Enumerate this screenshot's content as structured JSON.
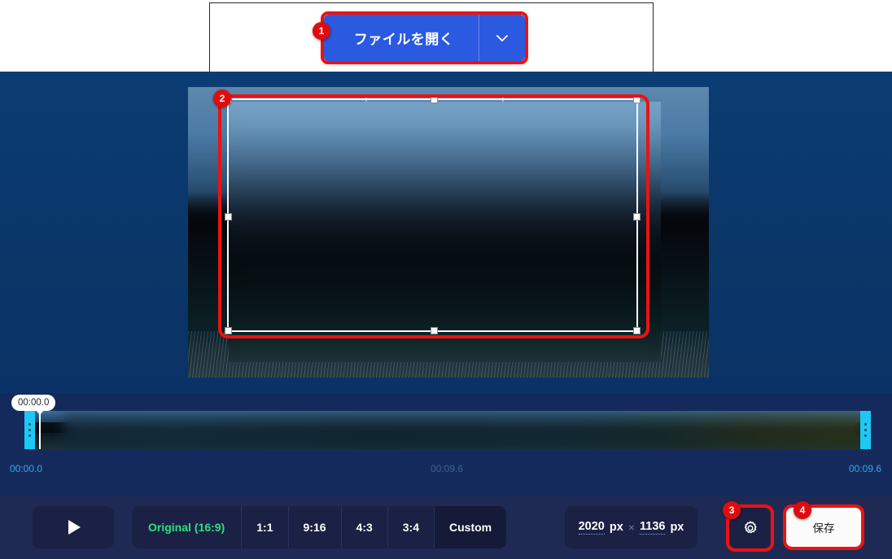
{
  "open_panel": {
    "button_label": "ファイルを開く",
    "caret_icon": "chevron-down-icon",
    "badge": "1",
    "accent_color": "#2b59e0"
  },
  "preview": {
    "badge": "2",
    "crop_overlay_color": "#ffffff",
    "highlight_color": "#ee1111"
  },
  "timeline": {
    "playhead_time": "00:00.0",
    "start_label": "00:00.0",
    "middle_label": "00:09.6",
    "end_label": "00:09.6",
    "trim_color": "#1ec8f5"
  },
  "toolbar": {
    "play_icon": "play-icon",
    "ratios": [
      {
        "label": "Original",
        "sub": "(16:9)",
        "selected": false,
        "highlight": true
      },
      {
        "label": "1:1",
        "sub": "",
        "selected": false,
        "highlight": false
      },
      {
        "label": "9:16",
        "sub": "",
        "selected": false,
        "highlight": false
      },
      {
        "label": "4:3",
        "sub": "",
        "selected": false,
        "highlight": false
      },
      {
        "label": "3:4",
        "sub": "",
        "selected": false,
        "highlight": false
      },
      {
        "label": "Custom",
        "sub": "",
        "selected": true,
        "highlight": false
      }
    ],
    "dimensions": {
      "width": "2020",
      "width_unit": "px",
      "separator": "×",
      "height": "1136",
      "height_unit": "px"
    },
    "settings": {
      "icon": "gear-icon",
      "badge": "3"
    },
    "save": {
      "label": "保存",
      "badge": "4"
    }
  }
}
